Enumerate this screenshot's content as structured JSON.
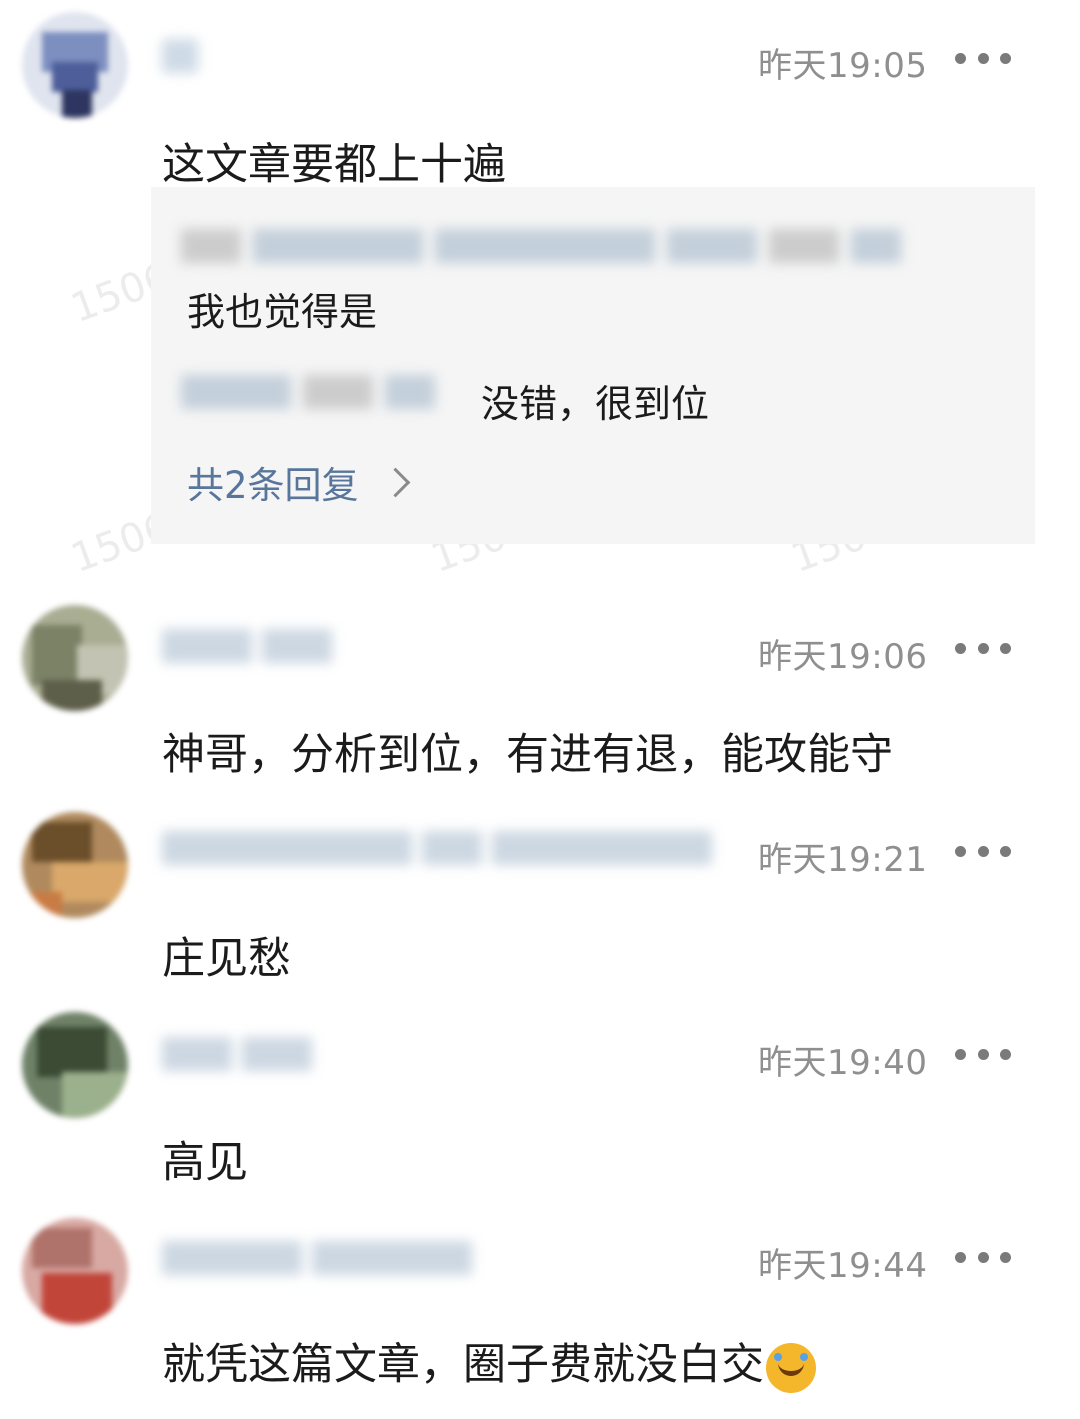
{
  "comments": [
    {
      "time": "昨天19:05",
      "text": "这文章要都上十遍"
    },
    {
      "time": "昨天19:06",
      "text": "神哥，分析到位，有进有退，能攻能守"
    },
    {
      "time": "昨天19:21",
      "text": "庄见愁"
    },
    {
      "time": "昨天19:40",
      "text": "高见"
    },
    {
      "time": "昨天19:44",
      "text": "就凭这篇文章，圈子费就没白交"
    }
  ],
  "replies": {
    "items": [
      {
        "text": "我也觉得是"
      },
      {
        "text": "没错，很到位"
      }
    ],
    "count_label": "共2条回复"
  },
  "watermark": "1506",
  "icons": {
    "more": "more-dots-icon",
    "chevron": "chevron-right-icon",
    "emoji": "laughing-tears-emoji-icon"
  }
}
